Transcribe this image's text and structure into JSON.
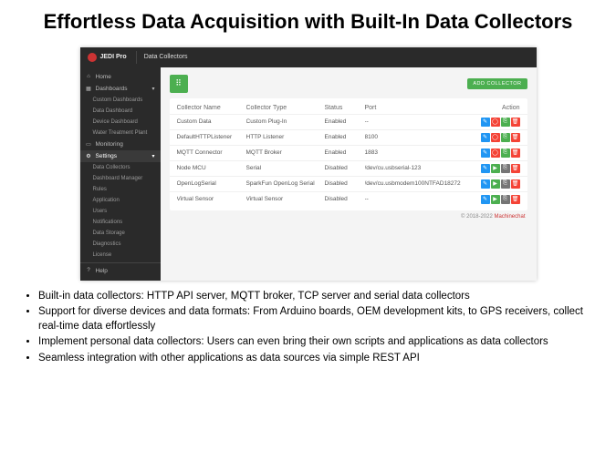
{
  "title": "Effortless Data Acquisition with Built-In Data Collectors",
  "brand": "JEDI Pro",
  "page": "Data Collectors",
  "addBtn": "ADD COLLECTOR",
  "nav": {
    "home": "Home",
    "dash": "Dashboards",
    "d1": "Custom Dashboards",
    "d2": "Data Dashboard",
    "d3": "Device Dashboard",
    "d4": "Water Treatment Plant",
    "mon": "Monitoring",
    "set": "Settings",
    "s1": "Data Collectors",
    "s2": "Dashboard Manager",
    "s3": "Rules",
    "s4": "Application",
    "s5": "Users",
    "s6": "Notifications",
    "s7": "Data Storage",
    "s8": "Diagnostics",
    "s9": "License",
    "help": "Help"
  },
  "cols": {
    "name": "Collector Name",
    "type": "Collector Type",
    "status": "Status",
    "port": "Port",
    "action": "Action"
  },
  "rows": [
    {
      "name": "Custom Data",
      "type": "Custom Plug-In",
      "status": "Enabled",
      "port": "--",
      "mode": "a"
    },
    {
      "name": "DefaultHTTPListener",
      "type": "HTTP Listener",
      "status": "Enabled",
      "port": "8100",
      "mode": "a"
    },
    {
      "name": "MQTT Connector",
      "type": "MQTT Broker",
      "status": "Enabled",
      "port": "1883",
      "mode": "a"
    },
    {
      "name": "Node MCU",
      "type": "Serial",
      "status": "Disabled",
      "port": "/dev/cu.usbserial-123",
      "mode": "b"
    },
    {
      "name": "OpenLogSerial",
      "type": "SparkFun OpenLog Serial",
      "status": "Disabled",
      "port": "/dev/cu.usbmodem100NTFAD18272",
      "mode": "b"
    },
    {
      "name": "Virtual Sensor",
      "type": "Virtual Sensor",
      "status": "Disabled",
      "port": "--",
      "mode": "b"
    }
  ],
  "footer": {
    "copy": "© 2018-2022 ",
    "vendor": "Machinechat"
  },
  "bullets": [
    "Built-in data collectors: HTTP  API server, MQTT broker, TCP  server and serial data collectors",
    "Support for diverse  devices and data formats: From Arduino boards,  OEM development  kits, to GPS receivers,  collect real-time data effortlessly",
    "Implement personal data collectors: Users can even  bring their own scripts and applications as data collectors",
    "Seamless integration with other applications as data sources via  simple REST API"
  ]
}
